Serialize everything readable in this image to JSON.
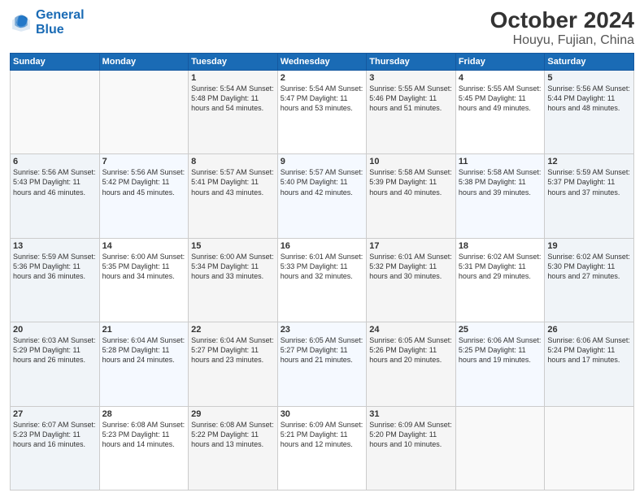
{
  "header": {
    "logo_line1": "General",
    "logo_line2": "Blue",
    "title": "October 2024",
    "subtitle": "Houyu, Fujian, China"
  },
  "weekdays": [
    "Sunday",
    "Monday",
    "Tuesday",
    "Wednesday",
    "Thursday",
    "Friday",
    "Saturday"
  ],
  "weeks": [
    [
      {
        "day": "",
        "info": ""
      },
      {
        "day": "",
        "info": ""
      },
      {
        "day": "1",
        "info": "Sunrise: 5:54 AM\nSunset: 5:48 PM\nDaylight: 11 hours and 54 minutes."
      },
      {
        "day": "2",
        "info": "Sunrise: 5:54 AM\nSunset: 5:47 PM\nDaylight: 11 hours and 53 minutes."
      },
      {
        "day": "3",
        "info": "Sunrise: 5:55 AM\nSunset: 5:46 PM\nDaylight: 11 hours and 51 minutes."
      },
      {
        "day": "4",
        "info": "Sunrise: 5:55 AM\nSunset: 5:45 PM\nDaylight: 11 hours and 49 minutes."
      },
      {
        "day": "5",
        "info": "Sunrise: 5:56 AM\nSunset: 5:44 PM\nDaylight: 11 hours and 48 minutes."
      }
    ],
    [
      {
        "day": "6",
        "info": "Sunrise: 5:56 AM\nSunset: 5:43 PM\nDaylight: 11 hours and 46 minutes."
      },
      {
        "day": "7",
        "info": "Sunrise: 5:56 AM\nSunset: 5:42 PM\nDaylight: 11 hours and 45 minutes."
      },
      {
        "day": "8",
        "info": "Sunrise: 5:57 AM\nSunset: 5:41 PM\nDaylight: 11 hours and 43 minutes."
      },
      {
        "day": "9",
        "info": "Sunrise: 5:57 AM\nSunset: 5:40 PM\nDaylight: 11 hours and 42 minutes."
      },
      {
        "day": "10",
        "info": "Sunrise: 5:58 AM\nSunset: 5:39 PM\nDaylight: 11 hours and 40 minutes."
      },
      {
        "day": "11",
        "info": "Sunrise: 5:58 AM\nSunset: 5:38 PM\nDaylight: 11 hours and 39 minutes."
      },
      {
        "day": "12",
        "info": "Sunrise: 5:59 AM\nSunset: 5:37 PM\nDaylight: 11 hours and 37 minutes."
      }
    ],
    [
      {
        "day": "13",
        "info": "Sunrise: 5:59 AM\nSunset: 5:36 PM\nDaylight: 11 hours and 36 minutes."
      },
      {
        "day": "14",
        "info": "Sunrise: 6:00 AM\nSunset: 5:35 PM\nDaylight: 11 hours and 34 minutes."
      },
      {
        "day": "15",
        "info": "Sunrise: 6:00 AM\nSunset: 5:34 PM\nDaylight: 11 hours and 33 minutes."
      },
      {
        "day": "16",
        "info": "Sunrise: 6:01 AM\nSunset: 5:33 PM\nDaylight: 11 hours and 32 minutes."
      },
      {
        "day": "17",
        "info": "Sunrise: 6:01 AM\nSunset: 5:32 PM\nDaylight: 11 hours and 30 minutes."
      },
      {
        "day": "18",
        "info": "Sunrise: 6:02 AM\nSunset: 5:31 PM\nDaylight: 11 hours and 29 minutes."
      },
      {
        "day": "19",
        "info": "Sunrise: 6:02 AM\nSunset: 5:30 PM\nDaylight: 11 hours and 27 minutes."
      }
    ],
    [
      {
        "day": "20",
        "info": "Sunrise: 6:03 AM\nSunset: 5:29 PM\nDaylight: 11 hours and 26 minutes."
      },
      {
        "day": "21",
        "info": "Sunrise: 6:04 AM\nSunset: 5:28 PM\nDaylight: 11 hours and 24 minutes."
      },
      {
        "day": "22",
        "info": "Sunrise: 6:04 AM\nSunset: 5:27 PM\nDaylight: 11 hours and 23 minutes."
      },
      {
        "day": "23",
        "info": "Sunrise: 6:05 AM\nSunset: 5:27 PM\nDaylight: 11 hours and 21 minutes."
      },
      {
        "day": "24",
        "info": "Sunrise: 6:05 AM\nSunset: 5:26 PM\nDaylight: 11 hours and 20 minutes."
      },
      {
        "day": "25",
        "info": "Sunrise: 6:06 AM\nSunset: 5:25 PM\nDaylight: 11 hours and 19 minutes."
      },
      {
        "day": "26",
        "info": "Sunrise: 6:06 AM\nSunset: 5:24 PM\nDaylight: 11 hours and 17 minutes."
      }
    ],
    [
      {
        "day": "27",
        "info": "Sunrise: 6:07 AM\nSunset: 5:23 PM\nDaylight: 11 hours and 16 minutes."
      },
      {
        "day": "28",
        "info": "Sunrise: 6:08 AM\nSunset: 5:23 PM\nDaylight: 11 hours and 14 minutes."
      },
      {
        "day": "29",
        "info": "Sunrise: 6:08 AM\nSunset: 5:22 PM\nDaylight: 11 hours and 13 minutes."
      },
      {
        "day": "30",
        "info": "Sunrise: 6:09 AM\nSunset: 5:21 PM\nDaylight: 11 hours and 12 minutes."
      },
      {
        "day": "31",
        "info": "Sunrise: 6:09 AM\nSunset: 5:20 PM\nDaylight: 11 hours and 10 minutes."
      },
      {
        "day": "",
        "info": ""
      },
      {
        "day": "",
        "info": ""
      }
    ]
  ]
}
